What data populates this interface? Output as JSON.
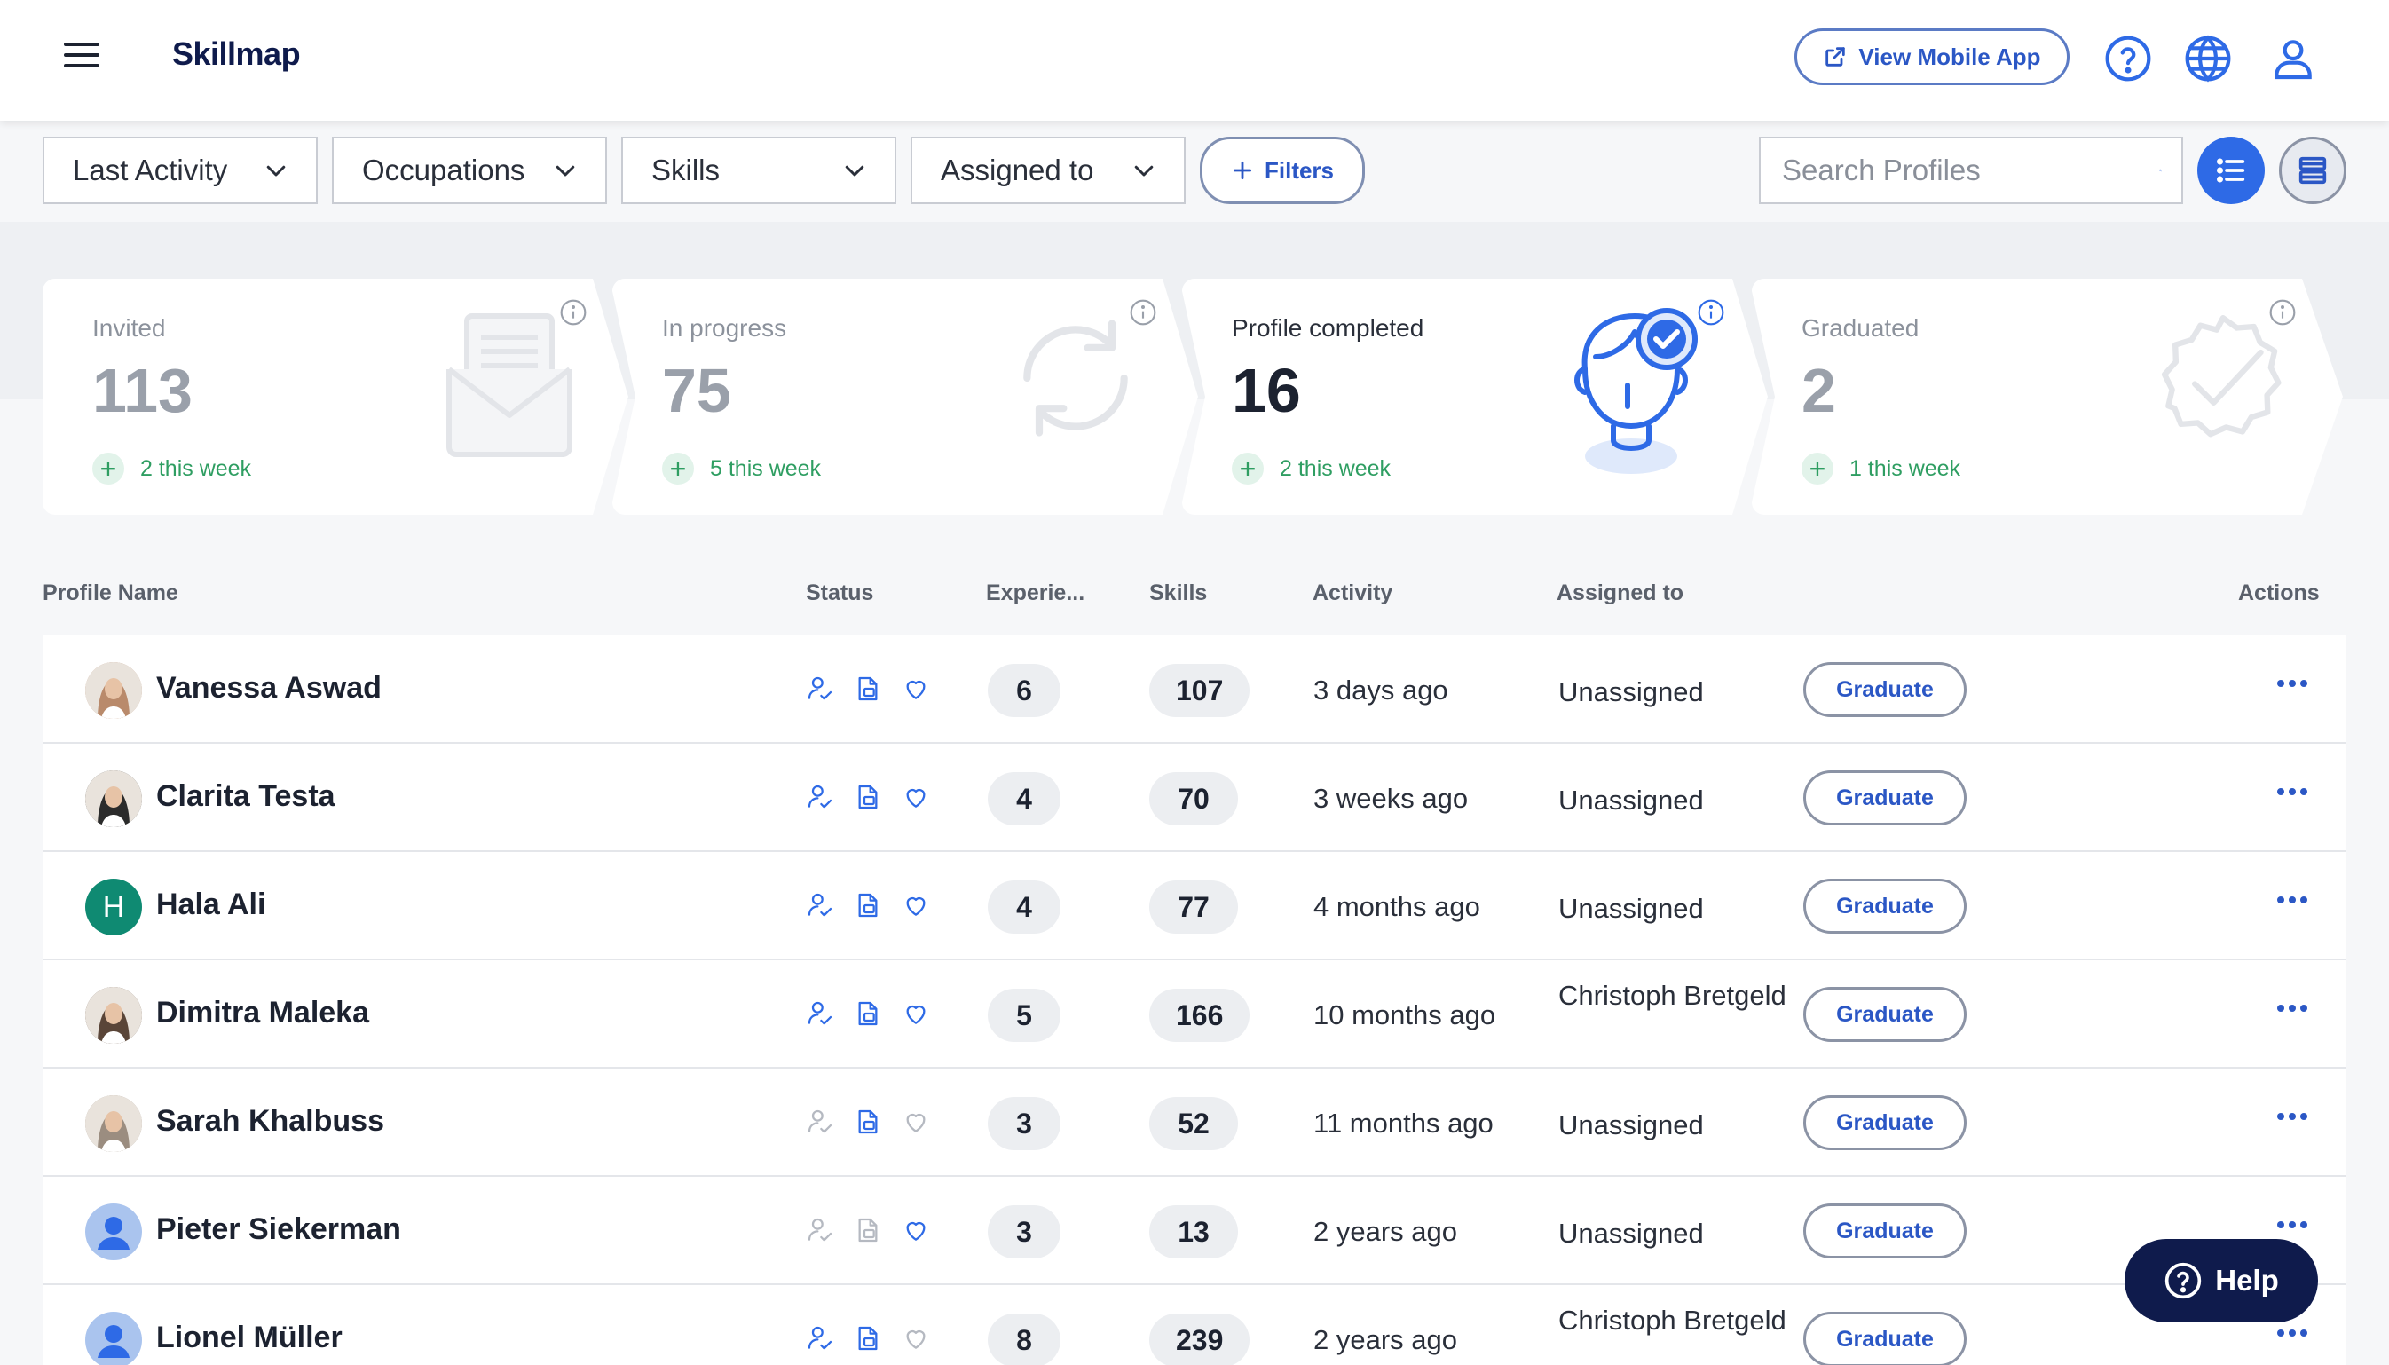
{
  "header": {
    "brand": "Skillmap",
    "view_mobile_label": "View Mobile App"
  },
  "filters": {
    "last_activity": "Last Activity",
    "occupations": "Occupations",
    "skills": "Skills",
    "assigned_to": "Assigned to",
    "filters_label": "Filters",
    "search_placeholder": "Search Profiles"
  },
  "stats": [
    {
      "label": "Invited",
      "count": "113",
      "week": "2 this week"
    },
    {
      "label": "In progress",
      "count": "75",
      "week": "5 this week"
    },
    {
      "label": "Profile completed",
      "count": "16",
      "week": "2 this week"
    },
    {
      "label": "Graduated",
      "count": "2",
      "week": "1 this week"
    }
  ],
  "colors": {
    "accent": "#2e6ae6",
    "brand_dark": "#0f1b4c",
    "positive": "#2f9e62"
  },
  "table": {
    "columns": {
      "profile_name": "Profile Name",
      "status": "Status",
      "experience": "Experie...",
      "skills": "Skills",
      "activity": "Activity",
      "assigned_to": "Assigned to",
      "actions": "Actions"
    },
    "graduate_label": "Graduate",
    "rows": [
      {
        "name": "Vanessa Aswad",
        "experience": "6",
        "skills": "107",
        "activity": "3 days ago",
        "assigned": "Unassigned",
        "avatar": "photo",
        "avatar_color": "#b98a6b"
      },
      {
        "name": "Clarita Testa",
        "experience": "4",
        "skills": "70",
        "activity": "3 weeks ago",
        "assigned": "Unassigned",
        "avatar": "photo",
        "avatar_color": "#2b2b2b"
      },
      {
        "name": "Hala Ali",
        "experience": "4",
        "skills": "77",
        "activity": "4 months ago",
        "assigned": "Unassigned",
        "avatar": "initial",
        "initial": "H",
        "avatar_color": "#0f8a72"
      },
      {
        "name": "Dimitra Maleka",
        "experience": "5",
        "skills": "166",
        "activity": "10 months ago",
        "assigned": "Christoph Bretgeld",
        "avatar": "photo",
        "avatar_color": "#5a4538"
      },
      {
        "name": "Sarah Khalbuss",
        "experience": "3",
        "skills": "52",
        "activity": "11 months ago",
        "assigned": "Unassigned",
        "avatar": "photo",
        "avatar_color": "#9b8d80"
      },
      {
        "name": "Pieter Siekerman",
        "experience": "3",
        "skills": "13",
        "activity": "2 years ago",
        "assigned": "Unassigned",
        "avatar": "generic",
        "avatar_color": "#aac4ee"
      },
      {
        "name": "Lionel Müller",
        "experience": "8",
        "skills": "239",
        "activity": "2 years ago",
        "assigned": "Christoph Bretgeld",
        "avatar": "generic",
        "avatar_color": "#aac4ee"
      }
    ]
  },
  "help": {
    "label": "Help"
  }
}
